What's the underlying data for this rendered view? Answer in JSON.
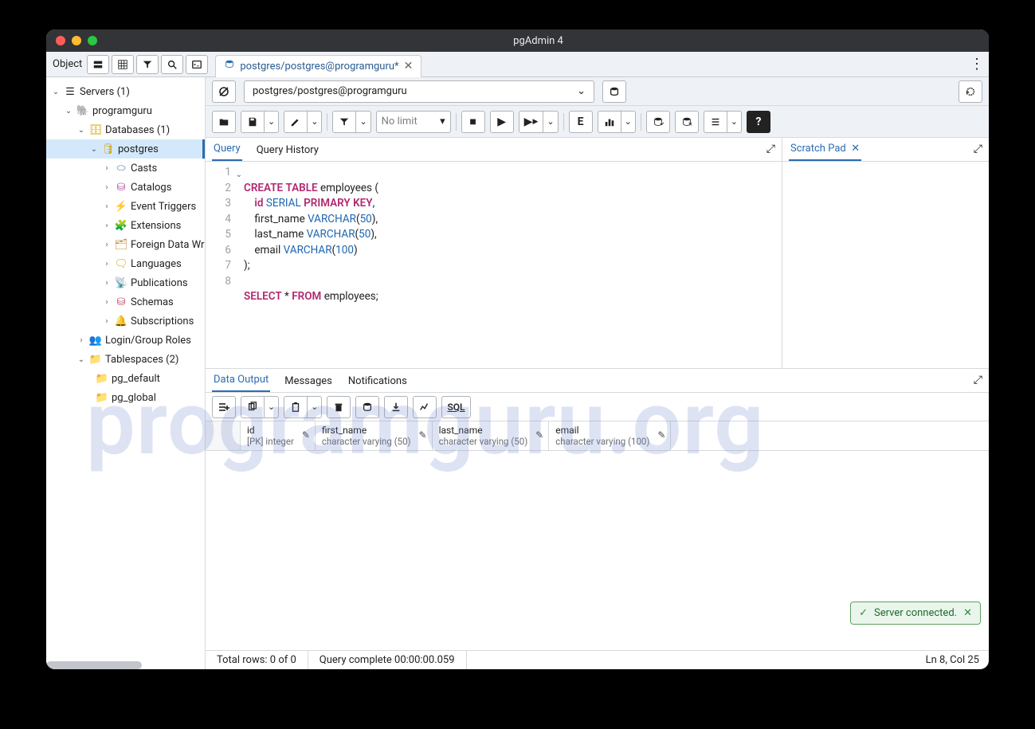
{
  "window": {
    "title": "pgAdmin 4"
  },
  "sidebar_label": "Object",
  "file_tab": {
    "label": "postgres/postgres@programguru*",
    "icon": "query-tool-icon"
  },
  "connection": {
    "value": "postgres/postgres@programguru",
    "disconnect_title": "Disconnect",
    "role_title": "Role"
  },
  "toolbar": {
    "no_limit": "No limit",
    "reset_title": "Reset layout"
  },
  "tree": {
    "servers": "Servers (1)",
    "server_name": "programguru",
    "databases": "Databases (1)",
    "db": "postgres",
    "casts": "Casts",
    "catalogs": "Catalogs",
    "event_triggers": "Event Triggers",
    "extensions": "Extensions",
    "fdw": "Foreign Data Wr",
    "languages": "Languages",
    "publications": "Publications",
    "schemas": "Schemas",
    "subscriptions": "Subscriptions",
    "login_roles": "Login/Group Roles",
    "tablespaces": "Tablespaces (2)",
    "ts1": "pg_default",
    "ts2": "pg_global"
  },
  "editor_tabs": {
    "query": "Query",
    "history": "Query History"
  },
  "scratch_tab": "Scratch Pad",
  "code": {
    "l1_a": "CREATE",
    "l1_b": "TABLE",
    "l1_c": " employees (",
    "l2_a": "    ",
    "l2_id": "id",
    "l2_b": " ",
    "l2_serial": "SERIAL",
    "l2_c": " ",
    "l2_pk": "PRIMARY",
    "l2_d": " ",
    "l2_key": "KEY",
    "l2_e": ",",
    "l3_a": "    first_name ",
    "l3_ty": "VARCHAR",
    "l3_b": "(",
    "l3_n": "50",
    "l3_c": "),",
    "l4_a": "    last_name ",
    "l4_ty": "VARCHAR",
    "l4_b": "(",
    "l4_n": "50",
    "l4_c": "),",
    "l5_a": "    email ",
    "l5_ty": "VARCHAR",
    "l5_b": "(",
    "l5_n": "100",
    "l5_c": ")",
    "l6": ");",
    "l8_a": "SELECT",
    "l8_b": " * ",
    "l8_c": "FROM",
    "l8_d": " employees;"
  },
  "output_tabs": {
    "data": "Data Output",
    "messages": "Messages",
    "notifications": "Notifications"
  },
  "out_toolbar": {
    "sql": "SQL"
  },
  "columns": [
    {
      "name": "id",
      "type": "[PK] integer"
    },
    {
      "name": "first_name",
      "type": "character varying (50)"
    },
    {
      "name": "last_name",
      "type": "character varying (50)"
    },
    {
      "name": "email",
      "type": "character varying (100)"
    }
  ],
  "status": {
    "rows": "Total rows: 0 of 0",
    "query": "Query complete 00:00:00.059",
    "pos": "Ln 8, Col 25"
  },
  "toast": "Server connected.",
  "watermark": "programguru.org"
}
